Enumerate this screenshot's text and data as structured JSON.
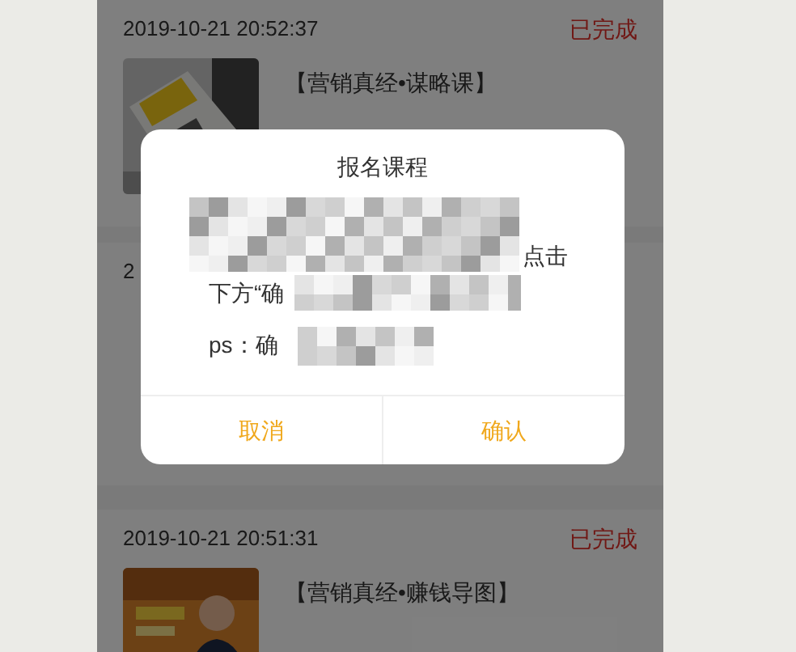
{
  "orders": [
    {
      "time": "2019-10-21 20:52:37",
      "status": "已完成",
      "title": "【营销真经•谋略课】"
    },
    {
      "time": "2"
    },
    {
      "time": "2019-10-21 20:51:31",
      "status": "已完成",
      "title": "【营销真经•赚钱导图】"
    }
  ],
  "dialog": {
    "title": "报名课程",
    "message_fragments": [
      "点击",
      "下方“确",
      "ps：确"
    ],
    "buttons": [
      {
        "label": "取消"
      },
      {
        "label": "确认"
      }
    ]
  }
}
